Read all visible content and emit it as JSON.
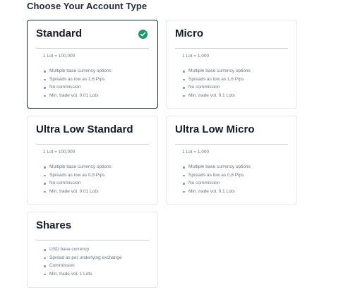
{
  "heading": "Choose Your Account Type",
  "accent_color": "#1c9a6c",
  "cards": [
    {
      "title": "Standard",
      "selected": true,
      "lot": "1 Lot = 100,000",
      "features": [
        "Multiple base currency options",
        "Spreads as low as 1.6 Pips",
        "No commission",
        "Min. trade vol. 0.01 Lots"
      ]
    },
    {
      "title": "Micro",
      "selected": false,
      "lot": "1 Lot = 1,000",
      "features": [
        "Multiple base currency options",
        "Spreads as low as 1.6 Pips",
        "No commission",
        "Min. trade vol. 0.1 Lots"
      ]
    },
    {
      "title": "Ultra Low Standard",
      "selected": false,
      "lot": "1 Lot = 100,000",
      "features": [
        "Multiple base currency options",
        "Spreads as low as 0.8 Pips",
        "No commission",
        "Min. trade vol. 0.01 Lots"
      ]
    },
    {
      "title": "Ultra Low Micro",
      "selected": false,
      "lot": "1 Lot = 1,000",
      "features": [
        "Multiple base currency options",
        "Spreads as low as 0.8 Pips",
        "No commission",
        "Min. trade vol. 0.1 Lots"
      ]
    },
    {
      "title": "Shares",
      "selected": false,
      "features": [
        "USD base currency",
        "Spread as per underlying exchange",
        "Commission",
        "Min. trade vol. 1 Lots"
      ]
    }
  ]
}
